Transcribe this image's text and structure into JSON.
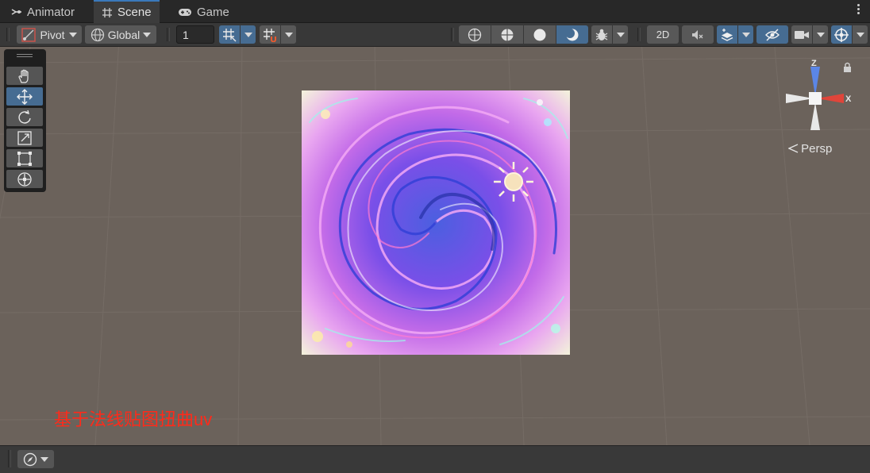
{
  "tabs": [
    {
      "label": "Animator",
      "icon": "animator-icon",
      "active": false
    },
    {
      "label": "Scene",
      "icon": "grid-icon",
      "active": true
    },
    {
      "label": "Game",
      "icon": "gamepad-icon",
      "active": false
    }
  ],
  "toolbar": {
    "pivot_label": "Pivot",
    "global_label": "Global",
    "grid_size_value": "1",
    "mode_2d_label": "2D"
  },
  "tools": [
    "hand-tool",
    "move-tool",
    "rotate-tool",
    "scale-tool",
    "rect-tool",
    "transform-tool"
  ],
  "selected_tool": "move-tool",
  "gizmo": {
    "y_axis_label": "Z",
    "x_axis_label": "X",
    "projection_label": "Persp"
  },
  "overlay_text": "基于法线贴图扭曲uv",
  "colors": {
    "accent_blue": "#466c92",
    "tab_highlight": "#3a79bb",
    "scene_bg": "#6b625b",
    "overlay_text": "#ff2a1a",
    "gizmo_x": "#e0453a",
    "gizmo_z": "#5b86e6"
  }
}
